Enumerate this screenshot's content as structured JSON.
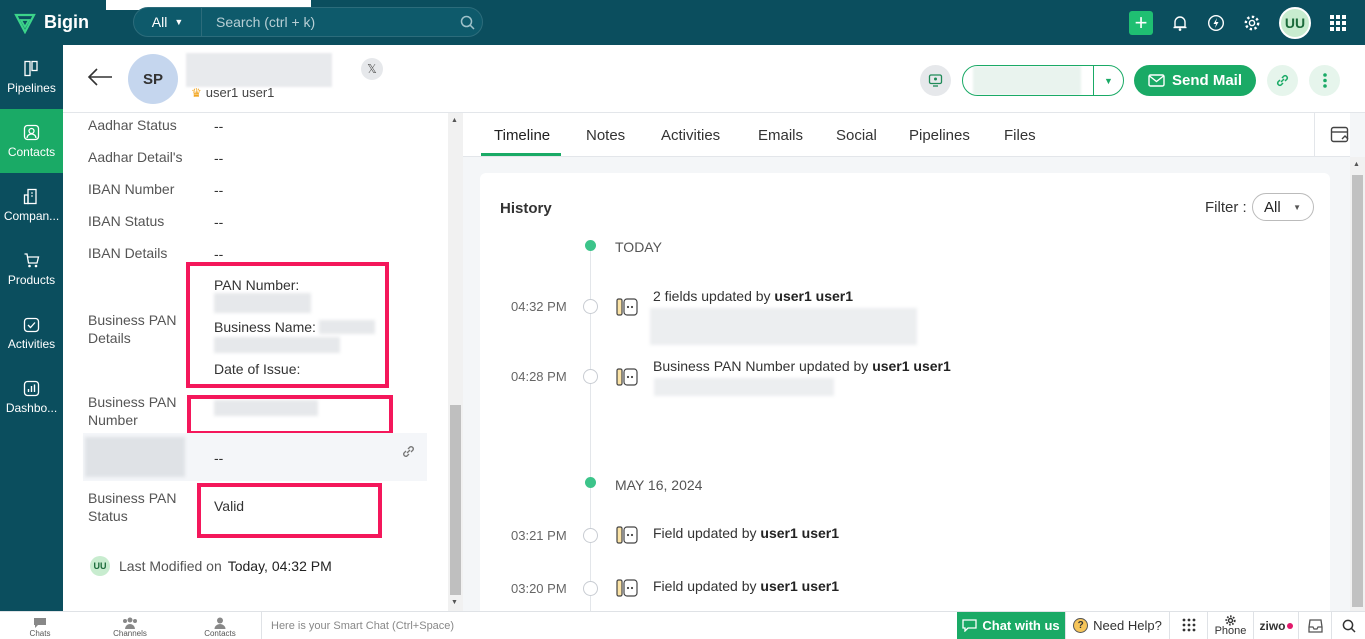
{
  "app": {
    "name": "Bigin"
  },
  "search": {
    "scope": "All",
    "placeholder": "Search (ctrl + k)"
  },
  "topbar": {
    "user_initials": "UU"
  },
  "nav": [
    {
      "label": "Pipelines",
      "icon": "pipelines-icon"
    },
    {
      "label": "Contacts",
      "icon": "contacts-icon",
      "active": true
    },
    {
      "label": "Compan...",
      "icon": "companies-icon"
    },
    {
      "label": "Products",
      "icon": "products-icon"
    },
    {
      "label": "Activities",
      "icon": "activities-icon"
    },
    {
      "label": "Dashbo...",
      "icon": "dashboards-icon"
    }
  ],
  "record": {
    "avatar_initials": "SP",
    "owner": "user1 user1",
    "social_badge": "𝕏",
    "send_mail": "Send Mail"
  },
  "details": {
    "fields": [
      {
        "label": "Aadhar Status",
        "value": "--"
      },
      {
        "label": "Aadhar Detail's",
        "value": "--"
      },
      {
        "label": "IBAN Number",
        "value": "--"
      },
      {
        "label": "IBAN Status",
        "value": "--"
      },
      {
        "label": "IBAN Details",
        "value": "--"
      }
    ],
    "business_pan_details": {
      "label": "Business PAN Details",
      "pan_number_label": "PAN Number:",
      "business_name_label": "Business Name:",
      "date_of_issue_label": "Date of Issue:"
    },
    "business_pan_number": {
      "label": "Business PAN Number"
    },
    "hover_row_value": "--",
    "business_pan_status": {
      "label": "Business PAN Status",
      "value": "Valid"
    },
    "last_modified": {
      "initials": "UU",
      "label": "Last Modified on",
      "value": "Today, 04:32 PM"
    }
  },
  "tabs": [
    "Timeline",
    "Notes",
    "Activities",
    "Emails",
    "Social",
    "Pipelines",
    "Files"
  ],
  "history": {
    "title": "History",
    "filter_label": "Filter :",
    "filter_value": "All",
    "groups": [
      {
        "date": "TODAY",
        "entries": [
          {
            "time": "04:32 PM",
            "text": "2 fields updated by ",
            "user": "user1 user1"
          },
          {
            "time": "04:28 PM",
            "text": "Business PAN Number updated by ",
            "user": "user1 user1"
          }
        ]
      },
      {
        "date": "MAY 16, 2024",
        "entries": [
          {
            "time": "03:21 PM",
            "text": "Field updated by ",
            "user": "user1 user1"
          },
          {
            "time": "03:20 PM",
            "text": "Field updated by ",
            "user": "user1 user1"
          }
        ]
      }
    ]
  },
  "bottombar": {
    "chats": "Chats",
    "channels": "Channels",
    "contacts": "Contacts",
    "smart_chat_placeholder": "Here is your Smart Chat (Ctrl+Space)",
    "chat_with_us": "Chat with us",
    "need_help": "Need Help?",
    "phone": "Phone",
    "ziwo": "ziwo"
  }
}
